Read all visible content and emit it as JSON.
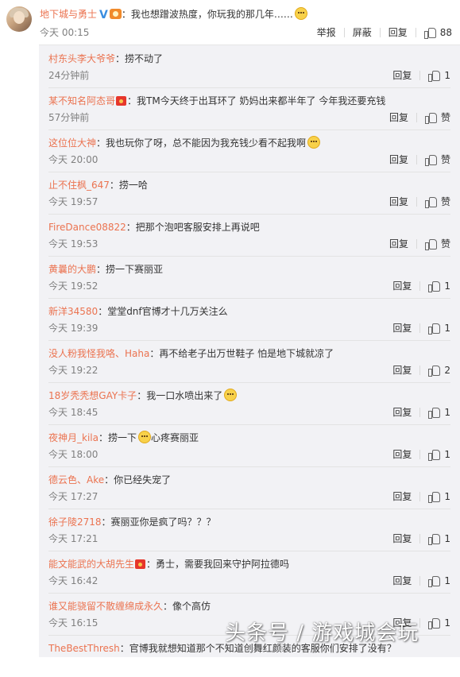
{
  "main_comment": {
    "user": "地下城与勇士",
    "text": "：我也想蹭波热度，你玩我的那几年……",
    "time": "今天 00:15",
    "actions": {
      "report": "举报",
      "block": "屏蔽",
      "reply": "回复"
    },
    "likes": "88"
  },
  "replies": [
    {
      "user": "村东头李大爷爷",
      "text": "：捞不动了",
      "time": "24分钟前",
      "reply": "回复",
      "likes": "1"
    },
    {
      "user": "某不知名阿态哥",
      "text": "：我TM今天终于出耳环了 奶妈出来都半年了 今年我还要充钱",
      "time": "57分钟前",
      "reply": "回复",
      "likes": "赞"
    },
    {
      "user": "这位位大神",
      "text": "：我也玩你了呀，总不能因为我充钱少看不起我啊",
      "time": "今天 20:00",
      "reply": "回复",
      "likes": "赞"
    },
    {
      "user": "止不住枫_647",
      "text": "：捞一哈",
      "time": "今天 19:57",
      "reply": "回复",
      "likes": "赞"
    },
    {
      "user": "FireDance08822",
      "text": "：把那个泡吧客服安排上再说吧",
      "time": "今天 19:53",
      "reply": "回复",
      "likes": "赞"
    },
    {
      "user": "黄曩的大鹏",
      "text": "：捞一下赛丽亚",
      "time": "今天 19:52",
      "reply": "回复",
      "likes": "1"
    },
    {
      "user": "新洋34580",
      "text": "：堂堂dnf官博才十几万关注么",
      "time": "今天 19:39",
      "reply": "回复",
      "likes": "1"
    },
    {
      "user": "没人粉我怪我咯、Haha",
      "text": "：再不给老子出万世鞋子 怕是地下城就凉了",
      "time": "今天 19:22",
      "reply": "回复",
      "likes": "2"
    },
    {
      "user": "18岁秃秃想GAY卡子",
      "text": "：我一口水喷出来了",
      "time": "今天 18:45",
      "reply": "回复",
      "likes": "1"
    },
    {
      "user": "夜神月_kila",
      "text": "：捞一下",
      "text2": "心疼赛丽亚",
      "time": "今天 18:00",
      "reply": "回复",
      "likes": "1"
    },
    {
      "user": "德云色、Ake",
      "text": "：你已经失宠了",
      "time": "今天 17:27",
      "reply": "回复",
      "likes": "1"
    },
    {
      "user": "徐子陵2718",
      "text": "：赛丽亚你是疯了吗？？？",
      "time": "今天 17:21",
      "reply": "回复",
      "likes": "1"
    },
    {
      "user": "能文能武的大胡先生",
      "text": "：勇士，需要我回来守护阿拉德吗",
      "time": "今天 16:42",
      "reply": "回复",
      "likes": "1"
    },
    {
      "user": "谁又能骁留不散缠绵成永久",
      "text": "：像个高仿",
      "time": "今天 16:15",
      "reply": "回复",
      "likes": "1"
    },
    {
      "user": "TheBestThresh",
      "text": "：官博我就想知道那个不知道创舞红颜装的客服你们安排了没有？",
      "time": "",
      "reply": "",
      "likes": ""
    }
  ],
  "watermark": "头条号 / 游戏城会玩",
  "colors": {
    "username": "#eb7350",
    "time": "#808080",
    "panel_bg": "#f2f2f5"
  }
}
